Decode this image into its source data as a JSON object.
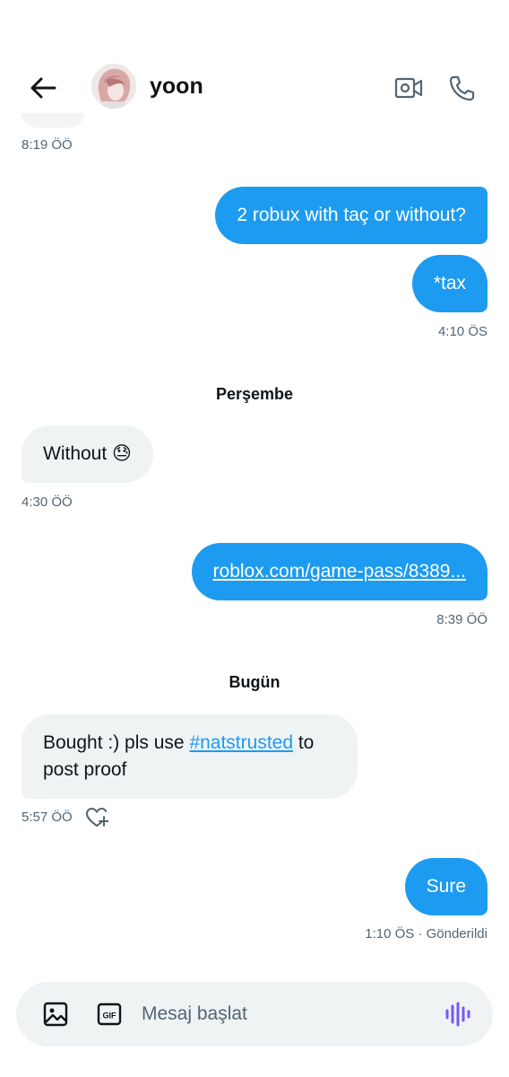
{
  "header": {
    "title": "yoon",
    "icons": {
      "back": "arrow-left-icon",
      "video": "video-camera-icon",
      "call": "phone-icon"
    }
  },
  "messages": {
    "prev_time": "8:19 ÖÖ",
    "out1_text": "2 robux with taç or without?",
    "out2_text": "*tax",
    "out2_time": "4:10 ÖS",
    "day1": "Perşembe",
    "in1_text": "Without 😓",
    "in1_time": "4:30 ÖÖ",
    "out3_link": "roblox.com/game-pass/8389...",
    "out3_time": "8:39 ÖÖ",
    "day2": "Bugün",
    "in2_pre": "Bought :) pls use ",
    "in2_hashtag": "#natstrusted",
    "in2_post": " to post proof",
    "in2_time": "5:57 ÖÖ",
    "out4_text": "Sure",
    "out4_status": "1:10 ÖS · Gönderildi"
  },
  "composer": {
    "placeholder": "Mesaj başlat",
    "gif_label": "GIF",
    "icons": {
      "media": "image-icon",
      "gif": "gif-icon",
      "voice": "voice-waveform-icon"
    }
  },
  "colors": {
    "accent": "#1d9bf0",
    "incoming_bubble": "#eff3f4",
    "secondary_text": "#536471",
    "voice": "#7856ff"
  }
}
